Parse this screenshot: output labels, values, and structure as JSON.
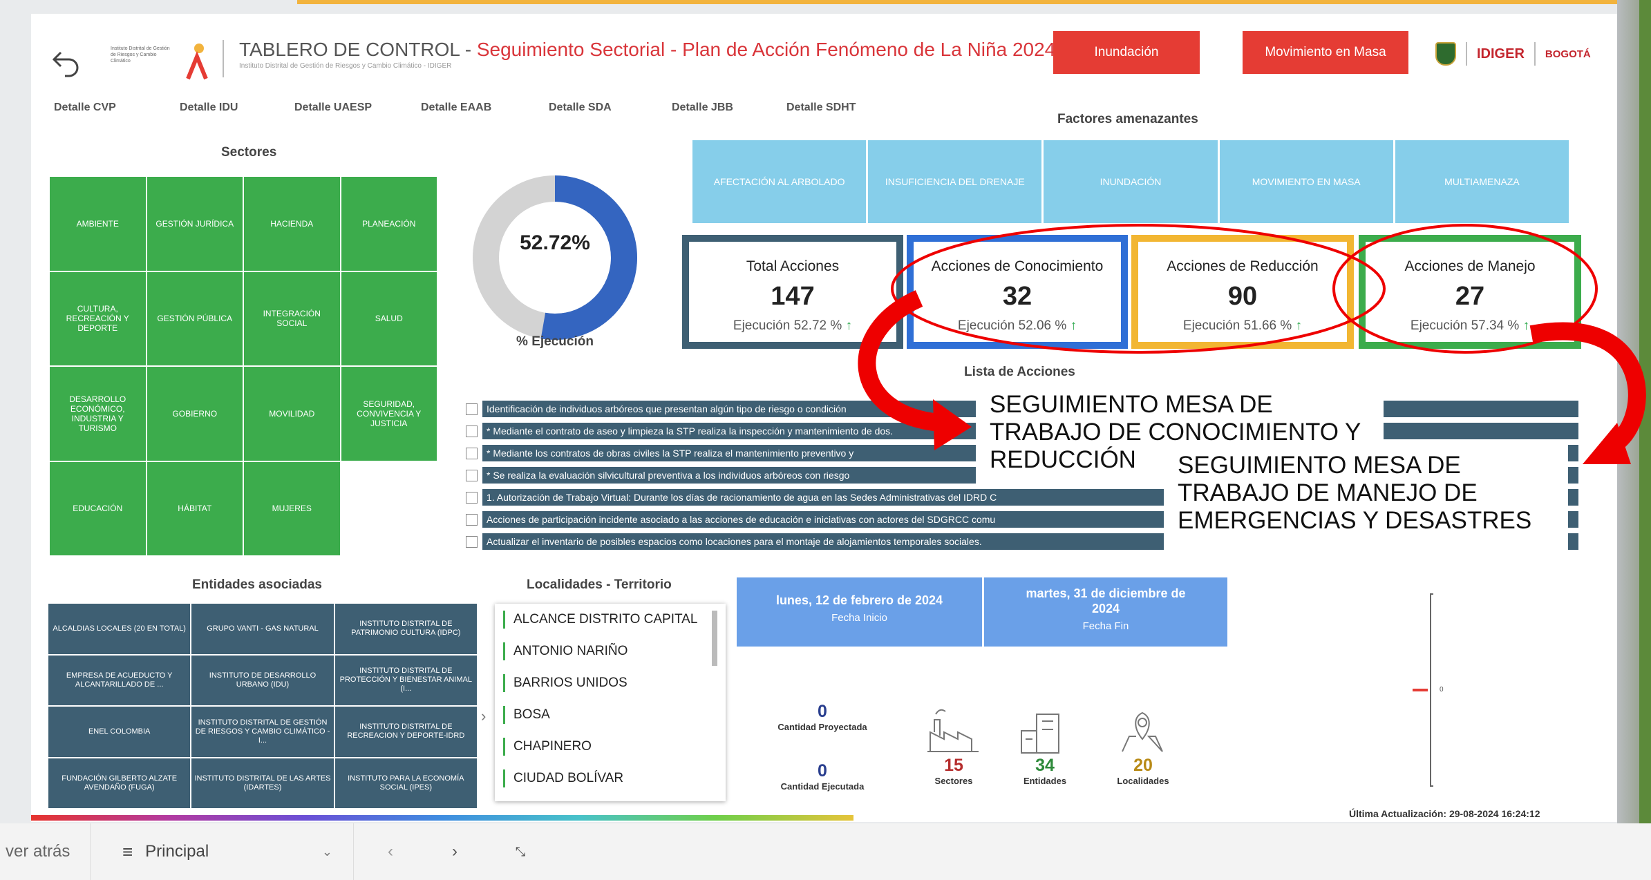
{
  "header": {
    "small_logo_text": "Instituto Distrital de Gestión de Riesgos y Cambio Climático",
    "title_main": "TABLERO DE CONTROL - ",
    "title_highlight": "Seguimiento Sectorial - Plan de Acción Fenómeno de La Niña 2024",
    "subtitle": "Instituto Distrital de Gestión de Riesgos y Cambio Climático - IDIGER",
    "btn_inundacion": "Inundación",
    "btn_movimiento": "Movimiento en Masa",
    "logo_idiger": "IDIGER",
    "logo_bogota": "BOGOTÁ",
    "colors": {
      "red": "#e53c34",
      "green": "#3cac4c",
      "navy": "#3e5f73",
      "lightblue": "#86ceea",
      "blue": "#6aa0e8"
    }
  },
  "tabs": [
    "Detalle CVP",
    "Detalle IDU",
    "Detalle UAESP",
    "Detalle EAAB",
    "Detalle SDA",
    "Detalle JBB",
    "Detalle SDHT"
  ],
  "sectores": {
    "title": "Sectores",
    "items": [
      "AMBIENTE",
      "GESTIÓN JURÍDICA",
      "HACIENDA",
      "PLANEACIÓN",
      "CULTURA, RECREACIÓN Y DEPORTE",
      "GESTIÓN PÚBLICA",
      "INTEGRACIÓN SOCIAL",
      "SALUD",
      "DESARROLLO ECONÓMICO, INDUSTRIA Y TURISMO",
      "GOBIERNO",
      "MOVILIDAD",
      "SEGURIDAD, CONVIVENCIA Y JUSTICIA",
      "EDUCACIÓN",
      "HÁBITAT",
      "MUJERES"
    ]
  },
  "ejecucion": {
    "value_text": "52.72%",
    "fraction": 0.5272,
    "label": "% Ejecución"
  },
  "factores": {
    "title": "Factores amenazantes",
    "items": [
      "AFECTACIÓN AL ARBOLADO",
      "INSUFICIENCIA DEL DRENAJE",
      "INUNDACIÓN",
      "MOVIMIENTO EN MASA",
      "MULTIAMENAZA"
    ]
  },
  "cards": [
    {
      "title": "Total Acciones",
      "value": "147",
      "exec": "Ejecución 52.72 %",
      "border": "#3e5f73"
    },
    {
      "title": "Acciones de Conocimiento",
      "value": "32",
      "exec": "Ejecución 52.06 %",
      "border": "#2f6fd6"
    },
    {
      "title": "Acciones de Reducción",
      "value": "90",
      "exec": "Ejecución 51.66 %",
      "border": "#f2b632"
    },
    {
      "title": "Acciones de Manejo",
      "value": "27",
      "exec": "Ejecución 57.34 %",
      "border": "#3cac4c"
    }
  ],
  "lista": {
    "title": "Lista de Acciones",
    "items": [
      "Identificación de individuos arbóreos que presentan algún tipo de riesgo o condición",
      "* Mediante el contrato de aseo y limpieza la STP realiza la inspección y mantenimiento de                                                                                    dos.",
      "* Mediante los contratos de obras civiles la STP realiza el mantenimiento preventivo y",
      "* Se realiza la evaluación silvicultural preventiva a los individuos arbóreos con riesgo",
      "1. Autorización de Trabajo Virtual: Durante los días de racionamiento de agua en las Sedes Administrativas del IDRD C",
      "Acciones de participación incidente asociado a las acciones de educación e iniciativas con actores del SDGRCC comu",
      "Actualizar el inventario de posibles espacios como locaciones para el montaje de alojamientos temporales sociales."
    ]
  },
  "entidades": {
    "title": "Entidades asociadas",
    "items": [
      "ALCALDIAS LOCALES (20 EN TOTAL)",
      "GRUPO VANTI - GAS NATURAL",
      "INSTITUTO DISTRITAL DE PATRIMONIO CULTURA (IDPC)",
      "EMPRESA DE ACUEDUCTO Y ALCANTARILLADO DE ...",
      "INSTITUTO DE DESARROLLO URBANO (IDU)",
      "INSTITUTO DISTRITAL DE PROTECCIÓN Y BIENESTAR ANIMAL (I...",
      "ENEL COLOMBIA",
      "INSTITUTO DISTRITAL DE GESTIÓN DE RIESGOS Y CAMBIO CLIMÁTICO - I...",
      "INSTITUTO DISTRITAL DE RECREACION Y DEPORTE-IDRD",
      "FUNDACIÓN GILBERTO ALZATE AVENDAÑO (FUGA)",
      "INSTITUTO DISTRITAL DE LAS ARTES (IDARTES)",
      "INSTITUTO PARA LA ECONOMÍA SOCIAL (IPES)"
    ]
  },
  "localidades": {
    "title": "Localidades - Territorio",
    "items": [
      "ALCANCE DISTRITO CAPITAL",
      "ANTONIO NARIÑO",
      "BARRIOS UNIDOS",
      "BOSA",
      "CHAPINERO",
      "CIUDAD BOLÍVAR"
    ]
  },
  "fechas": {
    "inicio": "lunes, 12 de febrero de 2024",
    "inicio_label": "Fecha Inicio",
    "fin": "martes, 31 de diciembre de 2024",
    "fin_label": "Fecha Fin"
  },
  "metrics": {
    "proyectada": "0",
    "proyectada_label": "Cantidad Proyectada",
    "ejecutada": "0",
    "ejecutada_label": "Cantidad Ejecutada",
    "sectores": "15",
    "sectores_label": "Sectores",
    "entidades": "34",
    "entidades_label": "Entidades",
    "localidades": "20",
    "localidades_label": "Localidades"
  },
  "mini_chart": {
    "value_label": "0"
  },
  "annotations": {
    "a1": "SEGUIMIENTO MESA DE TRABAJO DE CONOCIMIENTO Y REDUCCIÓN",
    "a2": "SEGUIMIENTO MESA DE TRABAJO DE MANEJO DE EMERGENCIAS Y DESASTRES"
  },
  "update": "Última Actualización: 29-08-2024 16:24:12",
  "bottom": {
    "back": "ver atrás",
    "page": "Principal"
  }
}
